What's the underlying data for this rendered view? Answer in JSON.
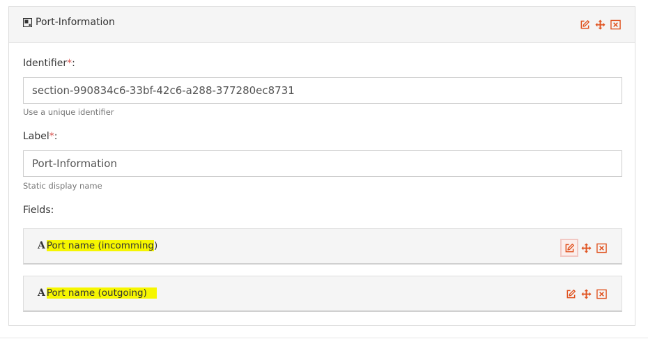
{
  "panel": {
    "title": "Port-Information"
  },
  "form": {
    "identifier": {
      "label": "Identifier",
      "required_mark": "*",
      "suffix": ":",
      "value": "section-990834c6-33bf-42c6-a288-377280ec8731",
      "help": "Use a unique identifier"
    },
    "label": {
      "label": "Label",
      "required_mark": "*",
      "suffix": ":",
      "value": "Port-Information",
      "help": "Static display name"
    },
    "fields_label": "Fields:",
    "fields": [
      {
        "type_glyph": "A",
        "name": "Port name (incomming",
        "tail": ")"
      },
      {
        "type_glyph": "A",
        "name": "Port name (outgoing)",
        "tail": ""
      }
    ]
  },
  "colors": {
    "accent": "#e0521f",
    "highlight": "#f6f600"
  },
  "icons": [
    "section-icon",
    "edit-icon",
    "move-icon",
    "close-icon"
  ]
}
